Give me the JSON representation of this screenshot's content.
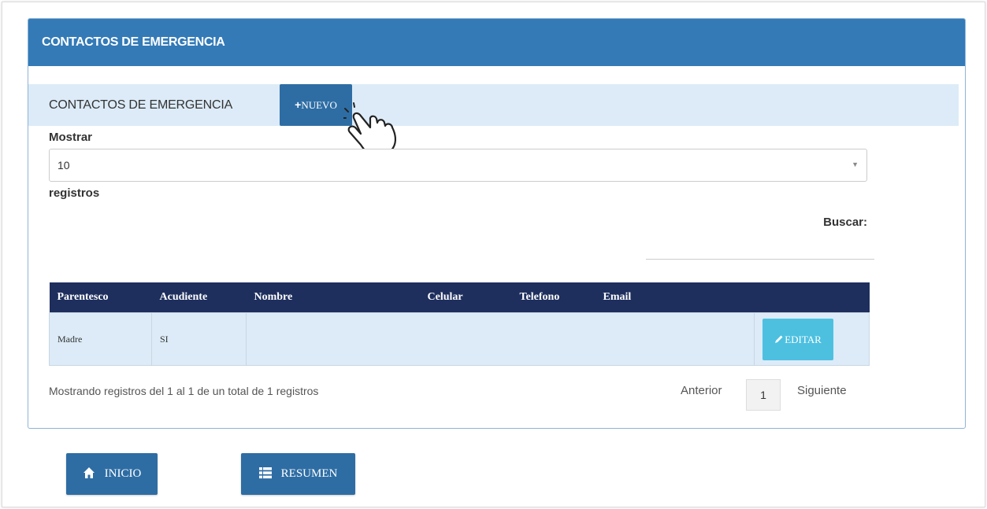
{
  "panel": {
    "title": "CONTACTOS DE EMERGENCIA"
  },
  "subbar": {
    "title": "CONTACTOS DE EMERGENCIA",
    "new_button_plus": "+",
    "new_button_label": "NUEVO"
  },
  "length_control": {
    "label_before": "Mostrar",
    "selected_value": "10",
    "label_after": "registros"
  },
  "search": {
    "label": "Buscar:",
    "value": ""
  },
  "table": {
    "columns": [
      "Parentesco",
      "Acudiente",
      "Nombre",
      "Celular",
      "Telefono",
      "Email",
      ""
    ],
    "rows": [
      {
        "parentesco": "Madre",
        "acudiente": "SI",
        "nombre": "",
        "celular": "",
        "telefono": "",
        "email": "",
        "action_label": "EDITAR"
      }
    ]
  },
  "info": {
    "text": "Mostrando registros del 1 al 1 de un total de 1 registros"
  },
  "pagination": {
    "previous_label": "Anterior",
    "current_page": "1",
    "next_label": "Siguiente"
  },
  "bottom_buttons": {
    "home_label": "INICIO",
    "summary_label": "RESUMEN"
  },
  "colors": {
    "header_blue": "#337ab7",
    "light_blue": "#dcebf7",
    "dark_navy": "#1e2f5e",
    "button_blue": "#2e6da4",
    "edit_cyan": "#4dc0e0"
  }
}
